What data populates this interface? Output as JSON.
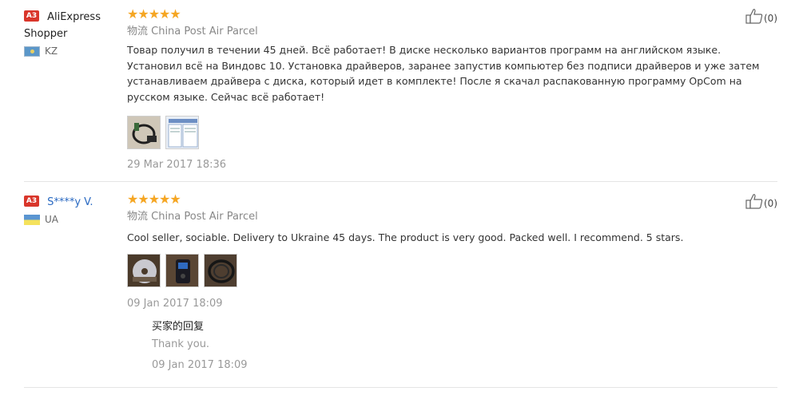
{
  "reviews": [
    {
      "level_badge": "A3",
      "user_name": "AliExpress Shopper",
      "country_code": "KZ",
      "rating": 5,
      "stars_display": "★★★★★",
      "logistics": "物流 China Post Air Parcel",
      "helpful_count": "(0)",
      "text": "Товар получил в течении 45 дней. Всё работает! В диске несколько вариантов программ на английском языке. Установил всё на Виндовс 10. Установка драйверов, заранее запустив компьютер без подписи драйверов и уже затем устанавливаем драйвера с диска, который идет в комплекте! После я скачал распакованную программу OpCom на русском языке. Сейчас всё работает!",
      "photos": [
        "cable-photo",
        "software-screenshot"
      ],
      "date": "29 Mar 2017 18:36"
    },
    {
      "level_badge": "A3",
      "user_name": "S****y V.",
      "country_code": "UA",
      "rating": 5,
      "stars_display": "★★★★★",
      "logistics": "物流 China Post Air Parcel",
      "helpful_count": "(0)",
      "text": "Cool seller, sociable. Delivery to Ukraine 45 days. The product is very good. Packed well. I recommend. 5 stars.",
      "photos": [
        "cd-photo",
        "device-photo",
        "cable-photo"
      ],
      "date": "09 Jan 2017 18:09",
      "reply": {
        "title": "买家的回复",
        "text": "Thank you.",
        "date": "09 Jan 2017 18:09"
      }
    }
  ],
  "colors": {
    "star": "#f5a623",
    "badge": "#d9362b",
    "link": "#2b6ac2"
  }
}
